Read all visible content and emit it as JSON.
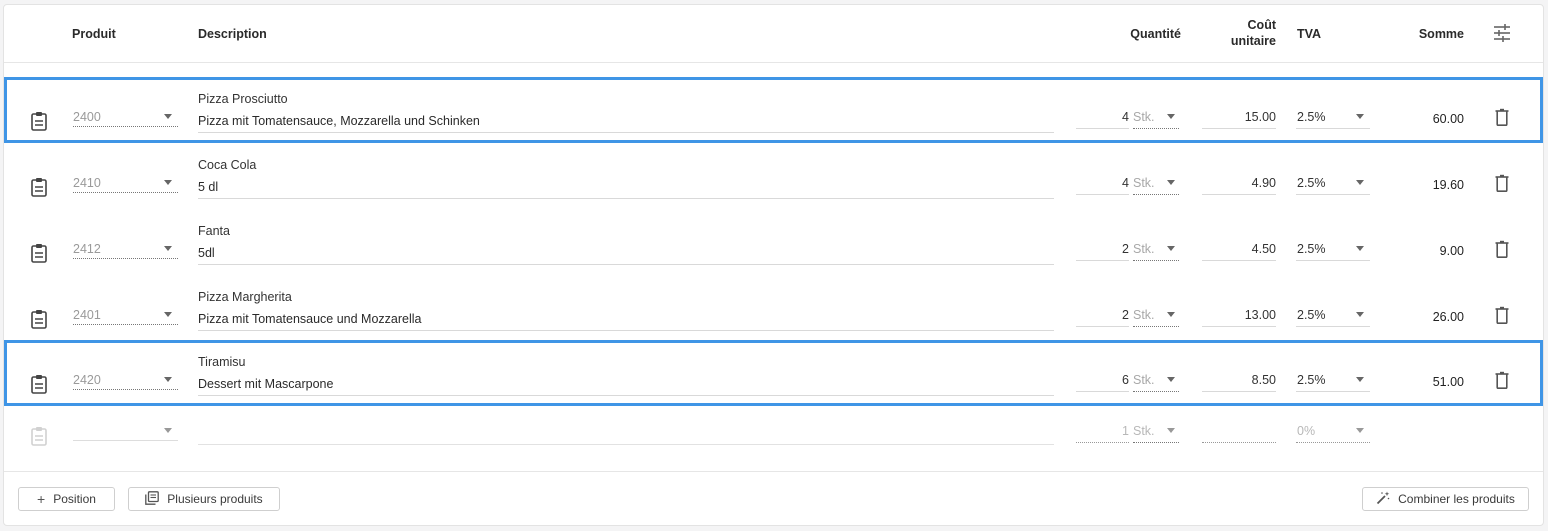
{
  "header": {
    "product": "Produit",
    "description": "Description",
    "quantity": "Quantité",
    "unit_cost": "Coût unitaire",
    "tva": "TVA",
    "sum": "Somme",
    "settings_icon": "tune-icon"
  },
  "rows": [
    {
      "product": "2400",
      "name": "Pizza Prosciutto",
      "description": "Pizza mit Tomatensauce, Mozzarella und Schinken",
      "quantity": "4",
      "unit": "Stk.",
      "unit_cost": "15.00",
      "tva": "2.5%",
      "sum": "60.00",
      "selected": true
    },
    {
      "product": "2410",
      "name": "Coca Cola",
      "description": "5 dl",
      "quantity": "4",
      "unit": "Stk.",
      "unit_cost": "4.90",
      "tva": "2.5%",
      "sum": "19.60",
      "selected": false
    },
    {
      "product": "2412",
      "name": "Fanta",
      "description": "5dl",
      "quantity": "2",
      "unit": "Stk.",
      "unit_cost": "4.50",
      "tva": "2.5%",
      "sum": "9.00",
      "selected": false
    },
    {
      "product": "2401",
      "name": "Pizza Margherita",
      "description": "Pizza mit Tomatensauce und Mozzarella",
      "quantity": "2",
      "unit": "Stk.",
      "unit_cost": "13.00",
      "tva": "2.5%",
      "sum": "26.00",
      "selected": false
    },
    {
      "product": "2420",
      "name": "Tiramisu",
      "description": "Dessert mit Mascarpone",
      "quantity": "6",
      "unit": "Stk.",
      "unit_cost": "8.50",
      "tva": "2.5%",
      "sum": "51.00",
      "selected": true
    }
  ],
  "new_row": {
    "product": "",
    "description": "",
    "quantity": "1",
    "unit": "Stk.",
    "unit_cost": "",
    "tva": "0%"
  },
  "footer": {
    "add_position": "Position",
    "multiple_products": "Plusieurs produits",
    "combine_products": "Combiner les produits"
  },
  "colors": {
    "selection_border": "#3f95e6"
  }
}
